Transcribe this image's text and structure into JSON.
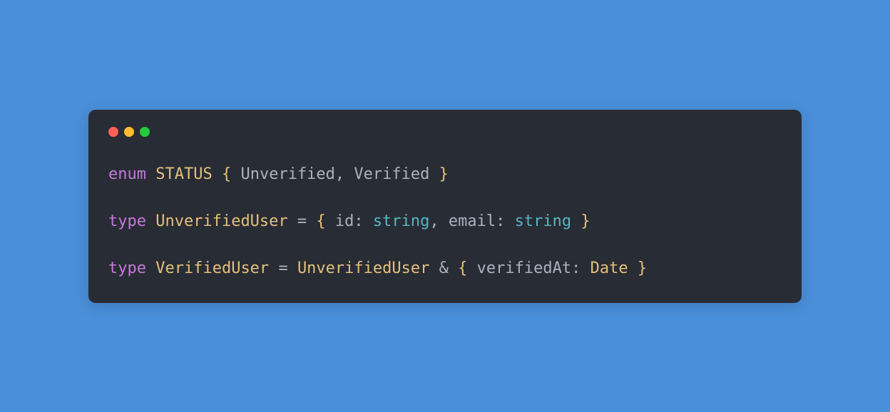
{
  "code": {
    "line1": {
      "enum": "enum",
      "status": "STATUS",
      "lbrace": "{",
      "unverified": "Unverified",
      "comma": ",",
      "verified": "Verified",
      "rbrace": "}"
    },
    "line2": {
      "type": "type",
      "unverifiedUser": "UnverifiedUser",
      "eq": "=",
      "lbrace": "{",
      "id": "id",
      "colon1": ":",
      "string1": "string",
      "comma": ",",
      "email": "email",
      "colon2": ":",
      "string2": "string",
      "rbrace": "}"
    },
    "line3": {
      "type": "type",
      "verifiedUser": "VerifiedUser",
      "eq": "=",
      "unverifiedUser": "UnverifiedUser",
      "amp": "&",
      "lbrace": "{",
      "verifiedAt": "verifiedAt",
      "colon": ":",
      "date": "Date",
      "rbrace": "}"
    }
  }
}
